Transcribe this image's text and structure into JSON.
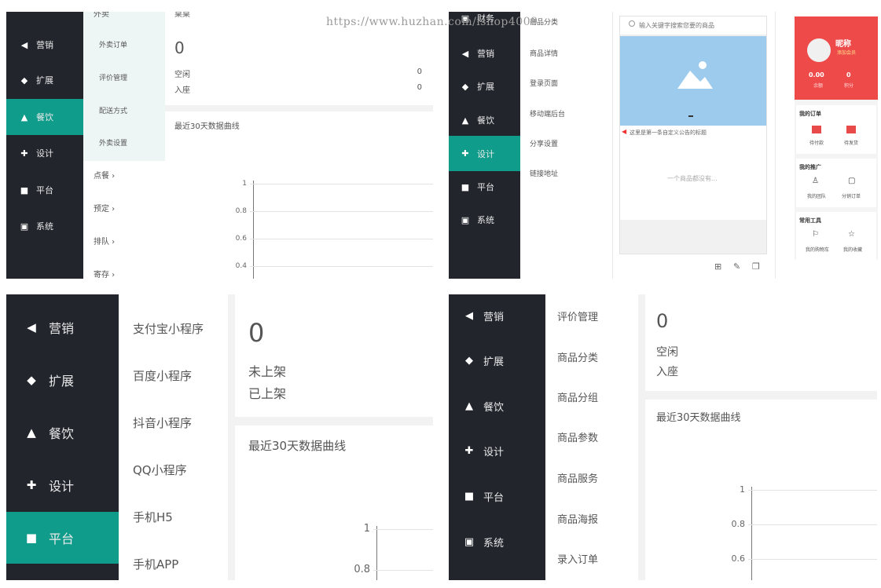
{
  "watermark": "https://www.huzhan.com/ishop4009",
  "nav": {
    "marketing": "营销",
    "extend": "扩展",
    "catering": "餐饮",
    "design": "设计",
    "platform": "平台",
    "system": "系统",
    "cut_top": "财务"
  },
  "panel_a": {
    "submenu_top": [
      "外卖订单",
      "评价管理",
      "配送方式",
      "外卖设置"
    ],
    "cut_top": "外卖",
    "groups": [
      "点餐",
      "预定",
      "排队",
      "寄存"
    ],
    "card_top_cut": "桌桌",
    "stat_big": "0",
    "stat_rows": [
      {
        "label": "空闲",
        "value": "0"
      },
      {
        "label": "入座",
        "value": "0"
      }
    ],
    "chart_title": "最近30天数据曲线"
  },
  "panel_b": {
    "submenu": [
      "商品详情",
      "登录页面",
      "移动端后台",
      "分享设置",
      "链接地址"
    ],
    "cut_top": "商品分类"
  },
  "panel_c": {
    "search_placeholder": "输入关键字搜索您要的商品",
    "notice": "这里是第一条自定义公告的标题",
    "empty": "一个商品都没有..."
  },
  "panel_d": {
    "nickname": "昵称",
    "tag": "添加会员",
    "stat1_value": "0.00",
    "stat1_label": "余额",
    "stat2_value": "0",
    "stat2_label": "积分",
    "my_orders": "我的订单",
    "order1": "待付款",
    "order2": "待发货",
    "promo": "我的推广",
    "promo1": "我的团队",
    "promo2": "分销订单",
    "tools": "常用工具",
    "tool1": "我的购物车",
    "tool2": "我的收藏"
  },
  "panel_e": {
    "submenu": [
      "支付宝小程序",
      "百度小程序",
      "抖音小程序",
      "QQ小程序",
      "手机H5",
      "手机APP"
    ],
    "stat_big": "0",
    "stat_rows": [
      "未上架",
      "已上架"
    ],
    "chart_title": "最近30天数据曲线"
  },
  "panel_f": {
    "submenu": [
      "评价管理",
      "商品分类",
      "商品分组",
      "商品参数",
      "商品服务",
      "商品海报",
      "录入订单"
    ],
    "stat_big": "0",
    "stat_rows": [
      "空闲",
      "入座"
    ],
    "chart_title": "最近30天数据曲线"
  },
  "chart_data": [
    {
      "type": "line",
      "title": "最近30天数据曲线",
      "yticks": [
        "1",
        "0.8",
        "0.6",
        "0.4"
      ],
      "series": []
    },
    {
      "type": "line",
      "title": "最近30天数据曲线",
      "yticks": [
        "1",
        "0.8"
      ],
      "series": []
    },
    {
      "type": "line",
      "title": "最近30天数据曲线",
      "yticks": [
        "1",
        "0.8",
        "0.6"
      ],
      "series": []
    }
  ],
  "colors": {
    "sidebar": "#22252c",
    "accent": "#109c8a",
    "profile_red": "#ee4a4a",
    "image_blue": "#9ccbee"
  }
}
